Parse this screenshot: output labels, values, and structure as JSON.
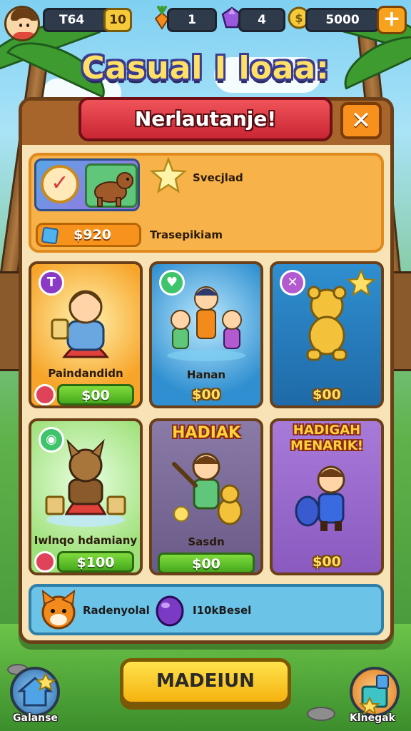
{
  "hud": {
    "player_id": "T64",
    "level": "10",
    "carrots": "1",
    "gems": "4",
    "coins": "5000",
    "plus": "+"
  },
  "title": "Casual I loaa:",
  "dialog": {
    "banner": "Nerlautanje!",
    "close": "✕"
  },
  "featured": {
    "label": "Svecjlad",
    "price": "$920",
    "sub_label": "Trasepikiam"
  },
  "cards": [
    {
      "label": "Paindandidn",
      "price": "$00",
      "badge": "T"
    },
    {
      "label": "Hanan",
      "price": "$00",
      "badge": "♥"
    },
    {
      "label": "",
      "price": "$00",
      "badge": "✕"
    },
    {
      "label": "Iwlnqo hdamiany",
      "price": "$100",
      "badge": "◉"
    },
    {
      "headline": "HADIAK",
      "label": "Sasdn",
      "price": "$00"
    },
    {
      "headline": "HADIGAH MENARIK!",
      "price": "$00"
    }
  ],
  "strip": {
    "left_text": "Radenyolal",
    "right_text": "I10kBesel"
  },
  "play_button": "MADEIUN",
  "bottom_left_label": "Galanse",
  "bottom_right_label": "Klnegak",
  "colors": {
    "panel": "#f7e3b5",
    "banner_red": "#e0353f",
    "accent_orange": "#f7931c",
    "price_green": "#46a91e",
    "play_yellow": "#f9cf28"
  }
}
